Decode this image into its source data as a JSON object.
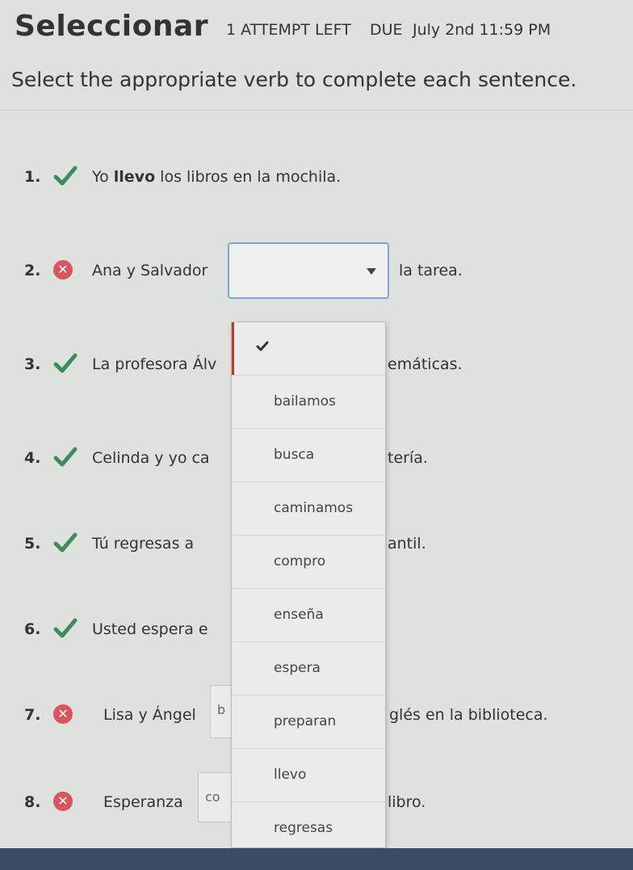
{
  "header": {
    "title": "Seleccionar",
    "attempts": "1 ATTEMPT LEFT",
    "due_label": "DUE",
    "due_date": "July 2nd 11:59 PM"
  },
  "instructions": "Select the appropriate verb to complete each sentence.",
  "questions": [
    {
      "num": "1.",
      "status": "correct",
      "before": "Yo",
      "answer": "llevo",
      "after": "los libros en la mochila."
    },
    {
      "num": "2.",
      "status": "incorrect",
      "before": "Ana y Salvador",
      "after": "la tarea."
    },
    {
      "num": "3.",
      "status": "correct",
      "before": "La profesora Álv",
      "after": "emáticas."
    },
    {
      "num": "4.",
      "status": "correct",
      "before": "Celinda y yo  ca",
      "after": "tería."
    },
    {
      "num": "5.",
      "status": "correct",
      "before": "Tú  regresas  a",
      "after": "antil."
    },
    {
      "num": "6.",
      "status": "correct",
      "before": "Usted  espera  e",
      "after": ""
    },
    {
      "num": "7.",
      "status": "incorrect",
      "before": "Lisa y Ángel",
      "box_text": "b",
      "after": "glés en la biblioteca."
    },
    {
      "num": "8.",
      "status": "incorrect",
      "before": "Esperanza",
      "box_text": "co",
      "after": "libro."
    }
  ],
  "dropdown": {
    "options": [
      "bailamos",
      "busca",
      "caminamos",
      "compro",
      "enseña",
      "espera",
      "preparan",
      "llevo",
      "regresas"
    ]
  },
  "colors": {
    "correct": "#3c8d5a",
    "incorrect": "#d9555d",
    "focus_border": "#7aa7d6"
  }
}
